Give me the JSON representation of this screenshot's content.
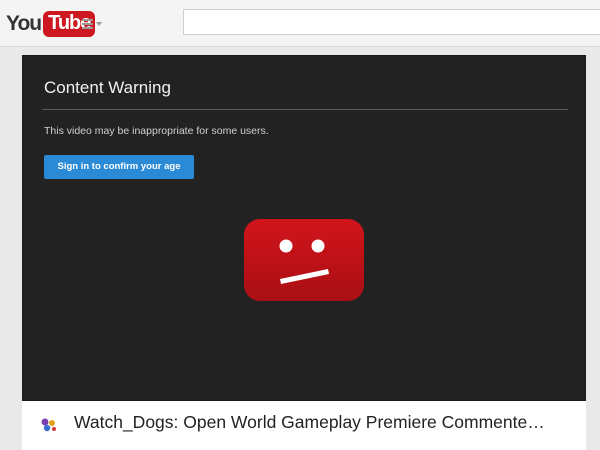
{
  "header": {
    "logo_you": "You",
    "logo_tube": "Tube",
    "search_placeholder": ""
  },
  "player": {
    "warning_title": "Content Warning",
    "warning_text": "This video may be inappropriate for some users.",
    "signin_label": "Sign in to confirm your age",
    "sad_icon": "sad-youtube-face-icon"
  },
  "video": {
    "title": "Watch_Dogs: Open World Gameplay Premiere Commente…",
    "channel_icon": "channel-logo-icon"
  },
  "colors": {
    "brand_red": "#cc181e",
    "button_blue": "#2a8ad6",
    "player_bg": "#222222"
  }
}
